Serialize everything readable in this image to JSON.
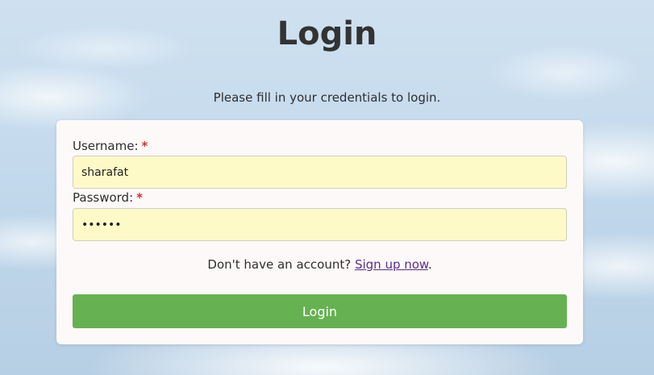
{
  "page": {
    "title": "Login",
    "subtitle": "Please fill in your credentials to login."
  },
  "form": {
    "username": {
      "label": "Username:",
      "required_mark": "*",
      "value": "sharafat"
    },
    "password": {
      "label": "Password:",
      "required_mark": "*",
      "value": "••••••"
    },
    "signup": {
      "prefix": "Don't have an account? ",
      "link_text": "Sign up now",
      "suffix": "."
    },
    "submit_label": "Login"
  },
  "colors": {
    "button": "#66b152",
    "input_background": "#fefac8",
    "link": "#5b2d8a",
    "required": "#cc3333"
  }
}
